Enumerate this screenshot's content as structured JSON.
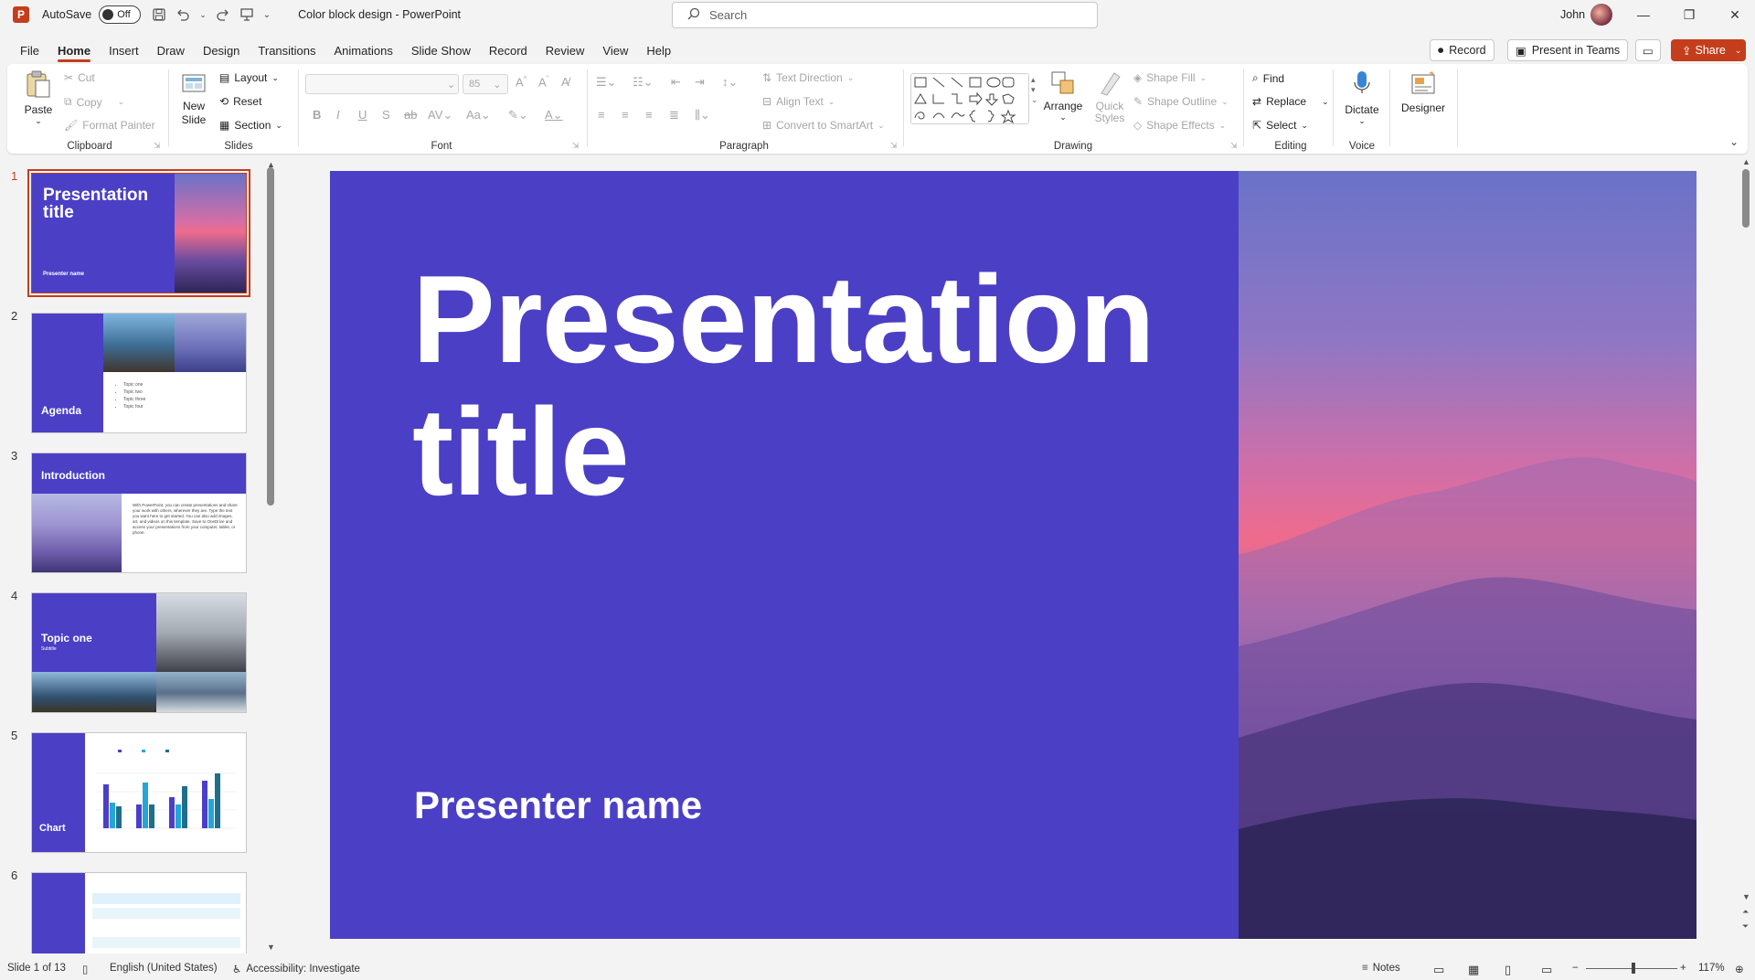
{
  "titlebar": {
    "app_logo": "P",
    "autosave_label": "AutoSave",
    "autosave_state": "Off",
    "document_title": "Color block design  -  PowerPoint",
    "search_placeholder": "Search",
    "user_name": "John",
    "icons": [
      "save-icon",
      "undo-icon",
      "redo-icon",
      "present-from-start-icon",
      "customize-quick-access-icon"
    ]
  },
  "menu": {
    "tabs": [
      "File",
      "Home",
      "Insert",
      "Draw",
      "Design",
      "Transitions",
      "Animations",
      "Slide Show",
      "Record",
      "Review",
      "View",
      "Help"
    ],
    "active_tab": "Home",
    "record_button": "Record",
    "present_in_teams_button": "Present in Teams",
    "share_button": "Share"
  },
  "ribbon": {
    "clipboard": {
      "label": "Clipboard",
      "paste": "Paste",
      "cut": "Cut",
      "copy": "Copy",
      "format_painter": "Format Painter"
    },
    "slides": {
      "label": "Slides",
      "new_slide": "New Slide",
      "layout": "Layout",
      "reset": "Reset",
      "section": "Section"
    },
    "font": {
      "label": "Font",
      "font_size": "85"
    },
    "paragraph": {
      "label": "Paragraph",
      "text_direction": "Text Direction",
      "align_text": "Align Text",
      "convert_smartart": "Convert to SmartArt"
    },
    "drawing": {
      "label": "Drawing",
      "arrange": "Arrange",
      "quick_styles_1": "Quick",
      "quick_styles_2": "Styles",
      "shape_fill": "Shape Fill",
      "shape_outline": "Shape Outline",
      "shape_effects": "Shape Effects"
    },
    "editing": {
      "label": "Editing",
      "find": "Find",
      "replace": "Replace",
      "select": "Select"
    },
    "voice": {
      "label": "Voice",
      "dictate": "Dictate"
    },
    "designer": {
      "designer": "Designer"
    }
  },
  "thumbnails": [
    {
      "number": "1",
      "title": "Presentation title",
      "subtitle": "Presenter name"
    },
    {
      "number": "2",
      "title": "Agenda",
      "bullets": [
        "Topic one",
        "Topic two",
        "Topic three",
        "Topic four"
      ]
    },
    {
      "number": "3",
      "title": "Introduction",
      "body": "With PowerPoint, you can create presentations and share your work with others, wherever they are. Type the text you want here to get started. You can also add images, art, and videos on this template. Save to OneDrive and access your presentations from your computer, tablet, or phone."
    },
    {
      "number": "4",
      "title": "Topic one",
      "subtitle": "Subtitle"
    },
    {
      "number": "5",
      "title": "Chart"
    },
    {
      "number": "6",
      "title": ""
    }
  ],
  "slide": {
    "title_line1": "Presentation",
    "title_line2": "title",
    "presenter": "Presenter name",
    "background_color": "#4b3fc6"
  },
  "statusbar": {
    "slide_counter": "Slide 1 of 13",
    "language": "English (United States)",
    "accessibility": "Accessibility: Investigate",
    "notes": "Notes",
    "zoom": "117%"
  },
  "colors": {
    "accent": "#c43e1c",
    "slide_bg": "#4b3fc6"
  }
}
